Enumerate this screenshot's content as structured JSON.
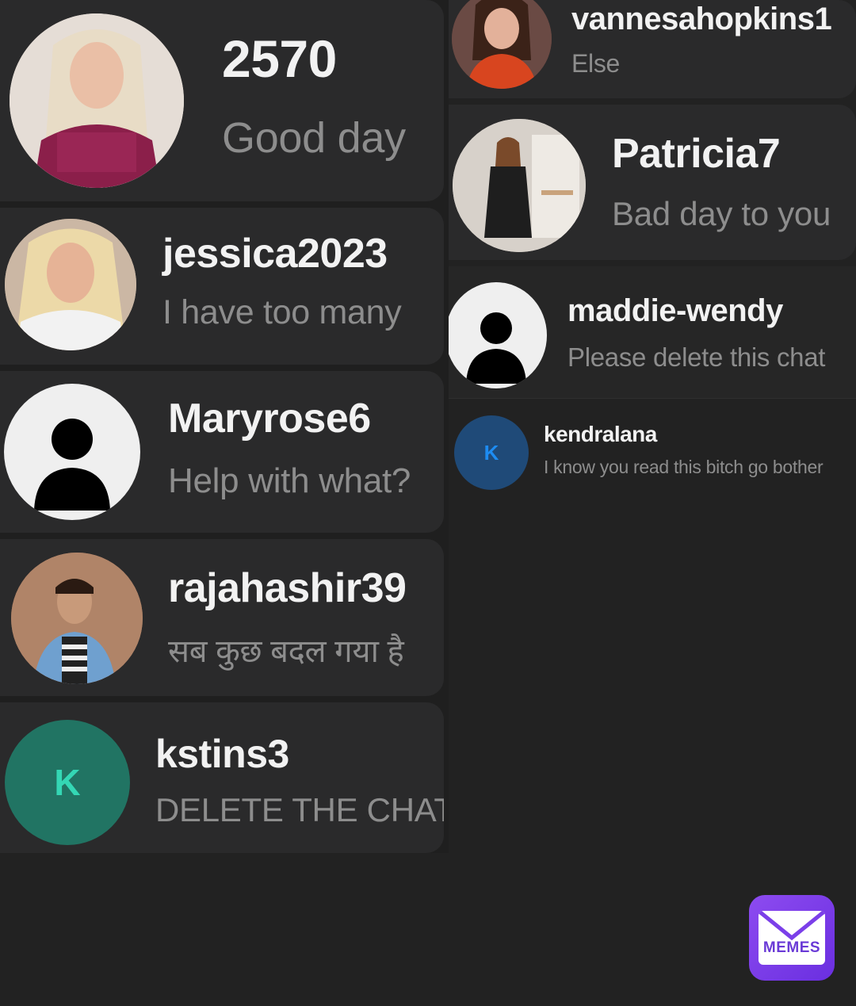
{
  "left_chats": [
    {
      "username": "2570",
      "preview": "Good day",
      "avatar": "photo-blonde-red-top"
    },
    {
      "username": "jessica2023",
      "preview": "I have too many",
      "avatar": "photo-blonde-white-top"
    },
    {
      "username": "Maryrose6",
      "preview": "Help with what?",
      "avatar": "default-person-icon"
    },
    {
      "username": "rajahashir39",
      "preview": "सब कुछ बदल गया है",
      "avatar": "photo-man-striped-shirt"
    },
    {
      "username": "kstins3",
      "preview": "DELETE THE CHAT",
      "avatar_letter": "K",
      "avatar_color": "#217463",
      "letter_color": "#34d7b4"
    }
  ],
  "right_chats": [
    {
      "username": "vannesahopkins1",
      "preview": "Else",
      "avatar": "photo-woman-red-top"
    },
    {
      "username": "Patricia7",
      "preview": "Bad day to you",
      "avatar": "photo-woman-polka-dress"
    },
    {
      "username": "maddie-wendy",
      "preview": "Please delete this chat",
      "avatar": "default-person-icon"
    },
    {
      "username": "kendralana",
      "preview": "I know you read this bitch go bother",
      "avatar_letter": "K",
      "avatar_color": "#1f4a78",
      "letter_color": "#1d8cf2"
    }
  ],
  "watermark": {
    "label": "MEMES",
    "icon": "envelope-icon",
    "bg": "#7b3fe9"
  }
}
